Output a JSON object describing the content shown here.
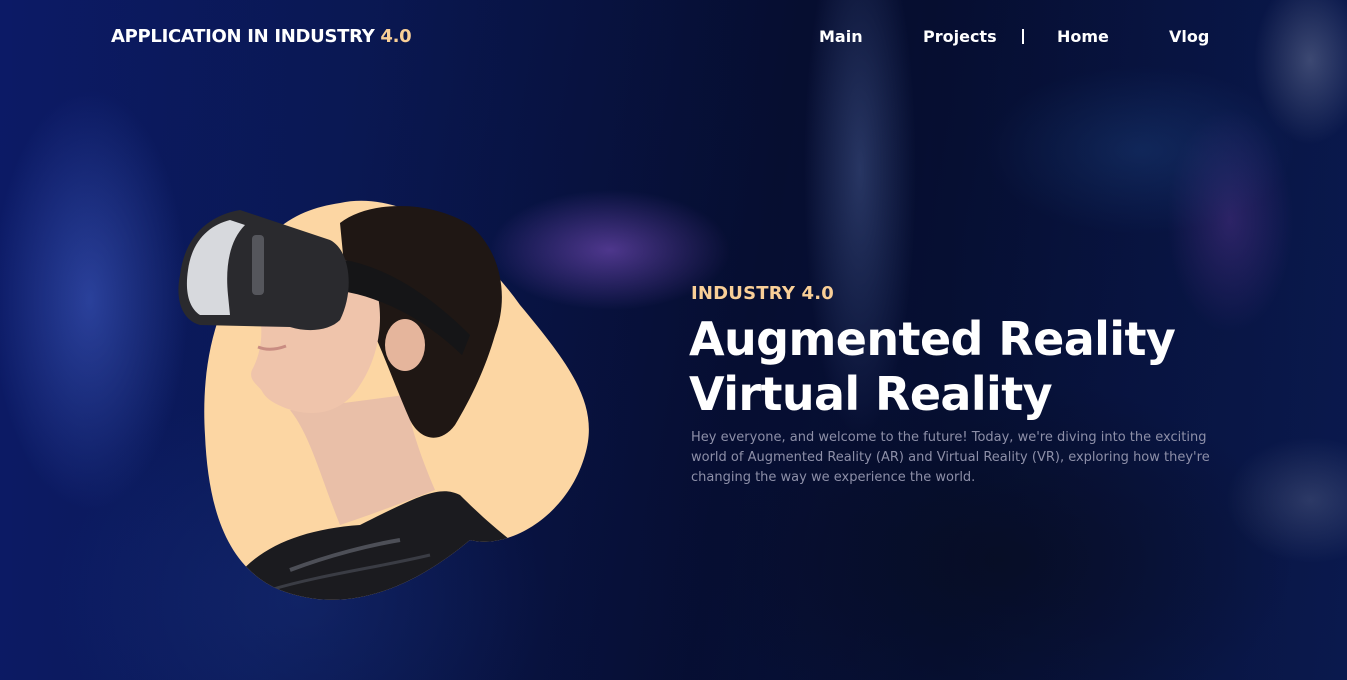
{
  "header": {
    "brand_text": "APPLICATION IN INDUSTRY ",
    "brand_accent": "4.0"
  },
  "nav": {
    "items": [
      {
        "label": "Main"
      },
      {
        "label": "Projects"
      },
      {
        "label": "Home"
      },
      {
        "label": "Vlog"
      }
    ]
  },
  "hero": {
    "eyebrow": "INDUSTRY 4.0",
    "title_line1": "Augmented Reality",
    "title_line2": "Virtual Reality",
    "description": "Hey everyone, and welcome to the future! Today, we're diving into the exciting world of Augmented Reality (AR) and Virtual Reality (VR), exploring how they're changing the way we experience the world."
  },
  "colors": {
    "accent": "#f9cf97",
    "text": "#ffffff",
    "muted": "#8d8fa8",
    "background": "#0b1a5c"
  }
}
